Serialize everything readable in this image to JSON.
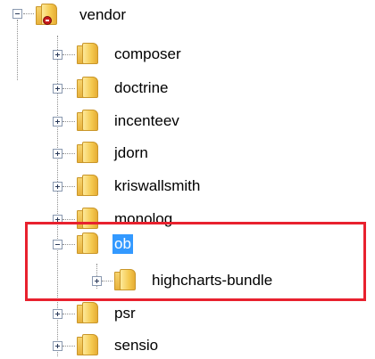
{
  "tree": {
    "root": {
      "label": "vendor",
      "expanded": true,
      "icon": "folder-with-error-badge-icon"
    },
    "children": [
      {
        "label": "composer",
        "expanded": false
      },
      {
        "label": "doctrine",
        "expanded": false
      },
      {
        "label": "incenteev",
        "expanded": false
      },
      {
        "label": "jdorn",
        "expanded": false
      },
      {
        "label": "kriswallsmith",
        "expanded": false
      },
      {
        "label": "monolog",
        "expanded": false
      },
      {
        "label": "ob",
        "expanded": true,
        "selected": true,
        "children": [
          {
            "label": "highcharts-bundle",
            "expanded": false
          }
        ]
      },
      {
        "label": "psr",
        "expanded": false
      },
      {
        "label": "sensio",
        "expanded": false
      }
    ]
  },
  "annotation": {
    "color": "#e8212e",
    "target": "ob"
  },
  "colors": {
    "selection": "#3399ff",
    "folder": "#f4c94f"
  }
}
